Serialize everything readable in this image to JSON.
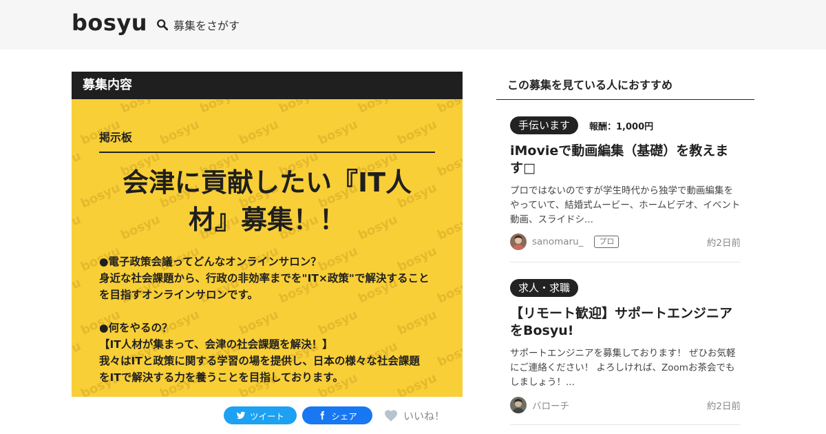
{
  "header": {
    "logo": "bosyu",
    "search_label": "募集をさがす"
  },
  "card": {
    "section_title": "募集内容",
    "board_label": "掲示板",
    "title_line1": "会津に貢献したい『IT人",
    "title_line2": "材』募集！！",
    "body": "●電子政策会議ってどんなオンラインサロン？\n身近な社会課題から、行政の非効率までを\"IT×政策\"で解決すること\nを目指すオンラインサロンです。\n\n●何をやるの？\n【IT人材が集まって、会津の社会課題を解決！】\n我々はITと政策に関する学習の場を提供し、日本の様々な社会課題\nをITで解決する力を養うことを目指しております。",
    "watermark_text": "bosyu",
    "bg_color": "#f8cf37"
  },
  "share": {
    "tweet_label": "ツイート",
    "facebook_label": "シェア",
    "like_label": "いいね！"
  },
  "sidebar": {
    "title": "この募集を見ている人におすすめ",
    "posts": [
      {
        "tag": "手伝います",
        "reward": "報酬：1,000円",
        "title": "iMovieで動画編集（基礎）を教えます□",
        "description": "プロではないのですが学生時代から独学で動画編集をやっていて、結婚式ムービー、ホームビデオ、イベント動画、スライドシ...",
        "user": "sanomaru_",
        "badge": "プロ",
        "time": "約2日前"
      },
      {
        "tag": "求人・求職",
        "title": "【リモート歓迎】サポートエンジニアをBosyu!",
        "description": "サポートエンジニアを募集しております！ ぜひお気軽にご連絡ください！ よろしければ、Zoomお茶会でもしましょう！...",
        "user": "バローチ",
        "time": "約2日前"
      }
    ]
  }
}
